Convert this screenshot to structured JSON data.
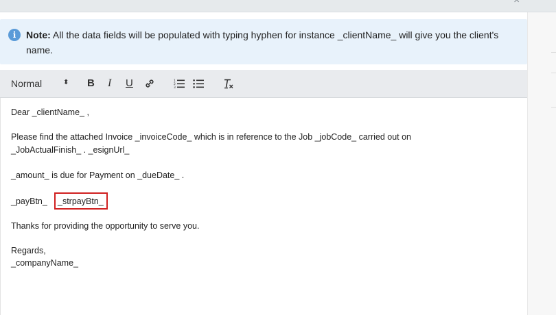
{
  "window": {
    "close_label": "×"
  },
  "note": {
    "label": "Note:",
    "text": "All the data fields will be populated with typing hyphen for instance _clientName_ will give you the client's name."
  },
  "toolbar": {
    "format_value": "Normal",
    "format_arrows": "⬍",
    "bold": "B",
    "italic": "I",
    "underline": "U"
  },
  "editor": {
    "line1": "Dear  _clientName_ ,",
    "line2": "Please find the attached Invoice  _invoiceCode_  which is in reference to the Job  _jobCode_  carried out on",
    "line3": " _JobActualFinish_ . _esignUrl_",
    "line4": " _amount_  is due for Payment on  _dueDate_ .",
    "line5a": " _payBtn_",
    "line5b": "_strpayBtn_",
    "line6": "Thanks for providing the opportunity to serve you.",
    "line7": "Regards,",
    "line8": " _companyName_"
  },
  "colors": {
    "note_bg": "#e8f2fb",
    "info_icon": "#5a9bd8",
    "highlight_border": "#d01f1f",
    "toolbar_bg": "#e9ebee"
  }
}
